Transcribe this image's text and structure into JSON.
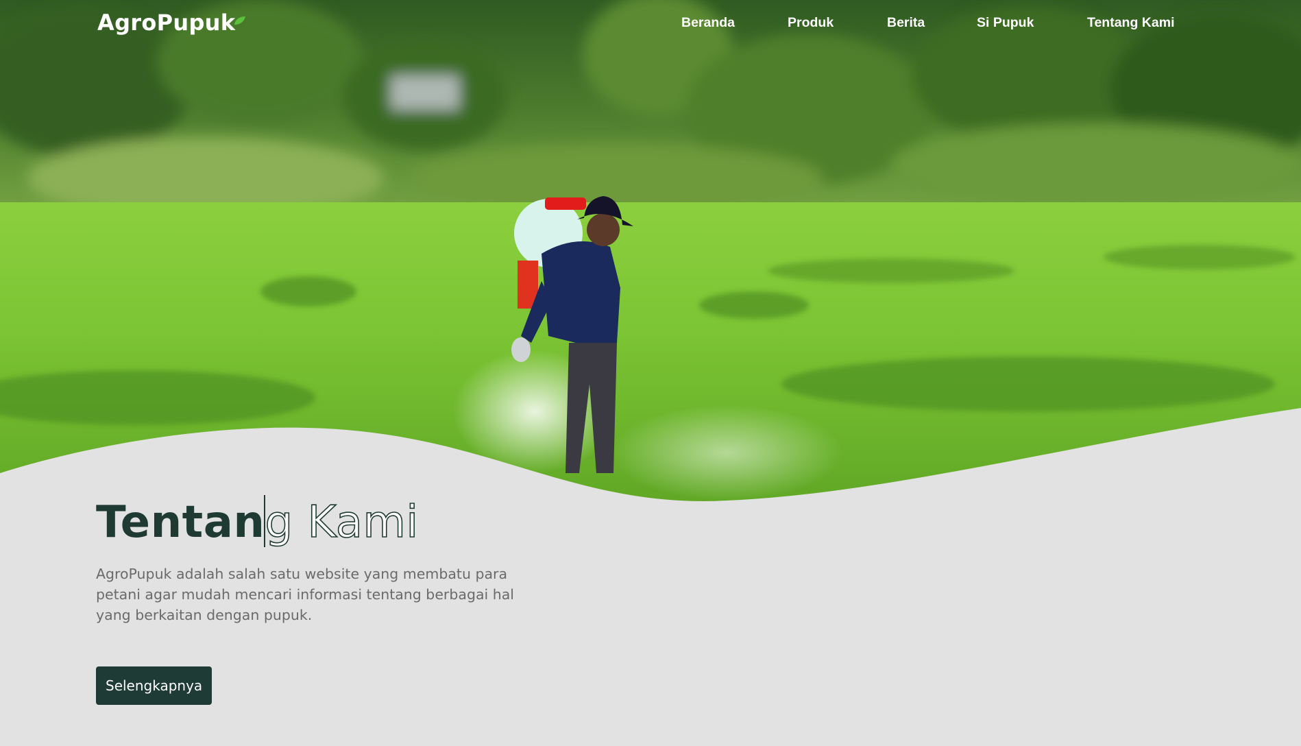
{
  "brand": {
    "name": "AgroPupuk"
  },
  "nav": {
    "items": [
      {
        "label": "Beranda"
      },
      {
        "label": "Produk"
      },
      {
        "label": "Berita"
      },
      {
        "label": "Si Pupuk"
      },
      {
        "label": "Tentang Kami"
      }
    ]
  },
  "hero": {
    "title_part1": "Tentan",
    "title_part2": "g Kami",
    "description": "AgroPupuk adalah salah satu website yang membatu para petani agar mudah mencari informasi tentang berbagai hal yang berkaitan dengan pupuk.",
    "cta_label": "Selengkapnya"
  },
  "colors": {
    "accent_dark": "#1e3b35",
    "background": "#e2e2e2",
    "text_muted": "#6a6a6a"
  },
  "icons": [
    "leaf-icon"
  ]
}
